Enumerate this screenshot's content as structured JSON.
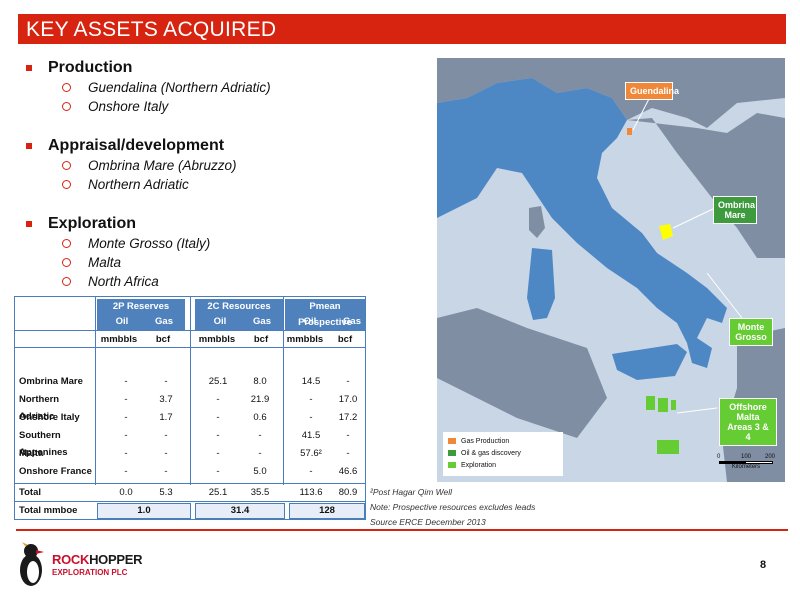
{
  "title": "KEY ASSETS ACQUIRED",
  "sections": [
    {
      "heading": "Production",
      "items": [
        "Guendalina (Northern Adriatic)",
        "Onshore Italy"
      ]
    },
    {
      "heading": "Appraisal/development",
      "items": [
        "Ombrina Mare (Abruzzo)",
        "Northern Adriatic"
      ]
    },
    {
      "heading": "Exploration",
      "items": [
        "Monte Grosso (Italy)",
        "Malta",
        "North Africa"
      ]
    }
  ],
  "table": {
    "groups": [
      "2P Reserves",
      "2C Resources",
      "Pmean Prospective"
    ],
    "subheads": [
      "Oil",
      "Gas",
      "Oil",
      "Gas",
      "Oil",
      "Gas"
    ],
    "units": [
      "mmbbls",
      "bcf",
      "mmbbls",
      "bcf",
      "mmbbls",
      "bcf"
    ],
    "rows": [
      {
        "name": "Ombrina Mare",
        "v": [
          "-",
          "-",
          "25.1",
          "8.0",
          "14.5",
          "-"
        ]
      },
      {
        "name": "Northern Adriatic",
        "v": [
          "-",
          "3.7",
          "-",
          "21.9",
          "-",
          "17.0"
        ]
      },
      {
        "name": "Onshore Italy",
        "v": [
          "-",
          "1.7",
          "-",
          "0.6",
          "-",
          "17.2"
        ]
      },
      {
        "name": "Southern Appenines",
        "v": [
          "-",
          "-",
          "-",
          "-",
          "41.5",
          "-"
        ]
      },
      {
        "name": "Malta",
        "v": [
          "-",
          "-",
          "-",
          "-",
          "57.6²",
          "-"
        ]
      },
      {
        "name": "Onshore France",
        "v": [
          "-",
          "-",
          "-",
          "5.0",
          "-",
          "46.6"
        ]
      }
    ],
    "total": {
      "name": "Total",
      "v": [
        "0.0",
        "5.3",
        "25.1",
        "35.5",
        "113.6",
        "80.9"
      ]
    },
    "total_mmboe": {
      "name": "Total mmboe",
      "v": [
        "1.0",
        "31.4",
        "128"
      ]
    }
  },
  "notes": [
    "²Post Hagar Qim Well",
    "Note: Prospective resources excludes leads",
    "Source ERCE December 2013"
  ],
  "map": {
    "callouts": {
      "guendalina": "Guendalina",
      "ombrina": "Ombrina Mare",
      "monte": "Monte Grosso",
      "malta": "Offshore Malta Areas 3 & 4"
    },
    "legend": [
      "Gas Production",
      "Oil & gas discovery",
      "Exploration"
    ],
    "scale": {
      "ticks": [
        "0",
        "100",
        "200"
      ],
      "unit": "Kilometers"
    },
    "colors": {
      "sea": "#c9d6e6",
      "italy": "#4d88c4",
      "land": "#7f8ea3",
      "gas_production": "#f0883a",
      "discovery": "#3d9a3d",
      "exploration": "#66cc33"
    }
  },
  "logo": {
    "word_a": "ROCK",
    "word_b": "HOPPER",
    "tagline": "EXPLORATION PLC"
  },
  "page_number": "8"
}
